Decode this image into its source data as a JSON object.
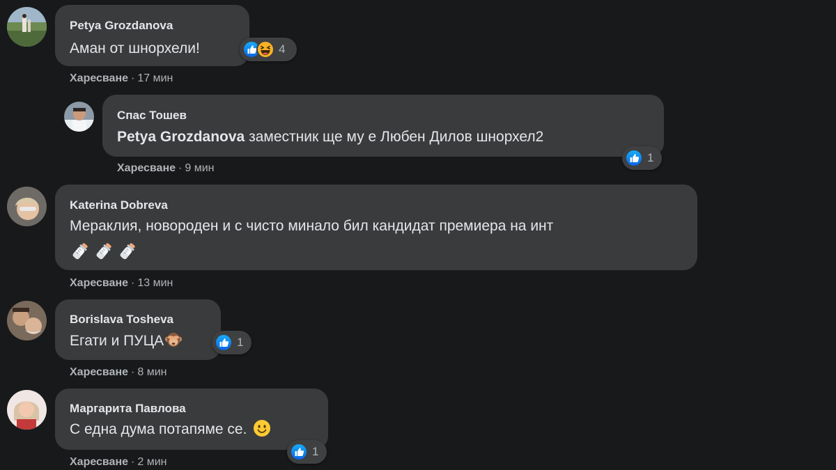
{
  "comments": [
    {
      "author": "Petya Grozdanova",
      "text": "Аман от шнорхели!",
      "like_label": "Харесване",
      "time": "17 мин",
      "reaction_count": "4",
      "reactions": [
        "like-icon",
        "laughing-icon"
      ]
    },
    {
      "author": "Спас Тошев",
      "mention": "Petya Grozdanova",
      "text": " заместник ще му е Любен Дилов шнорхел2",
      "like_label": "Харесване",
      "time": "9 мин",
      "reaction_count": "1",
      "reactions": [
        "like-icon"
      ]
    },
    {
      "author": "Katerina Dobreva",
      "text": "Мераклия, новороден и с чисто минало бил кандидат премиера на инт",
      "emoji_line": [
        "baby-bottle-icon",
        "baby-bottle-icon",
        "baby-bottle-icon"
      ],
      "like_label": "Харесване",
      "time": "13 мин"
    },
    {
      "author": "Borislava Tosheva",
      "text": "Егати и ПУЦА",
      "trailing_emoji": "see-no-evil-monkey-icon",
      "like_label": "Харесване",
      "time": "8 мин",
      "reaction_count": "1",
      "reactions": [
        "like-icon"
      ]
    },
    {
      "author": "Маргарита Павлова",
      "text": "С една дума потапяме се.",
      "trailing_emoji": "slightly-smiling-face-icon",
      "like_label": "Харесване",
      "time": "2 мин",
      "reaction_count": "1",
      "reactions": [
        "like-icon"
      ]
    }
  ],
  "colors": {
    "background": "#18191a",
    "bubble": "#3a3b3c",
    "text": "#e4e6eb",
    "meta": "#b0b3b8",
    "like_blue": "#1877f2"
  }
}
